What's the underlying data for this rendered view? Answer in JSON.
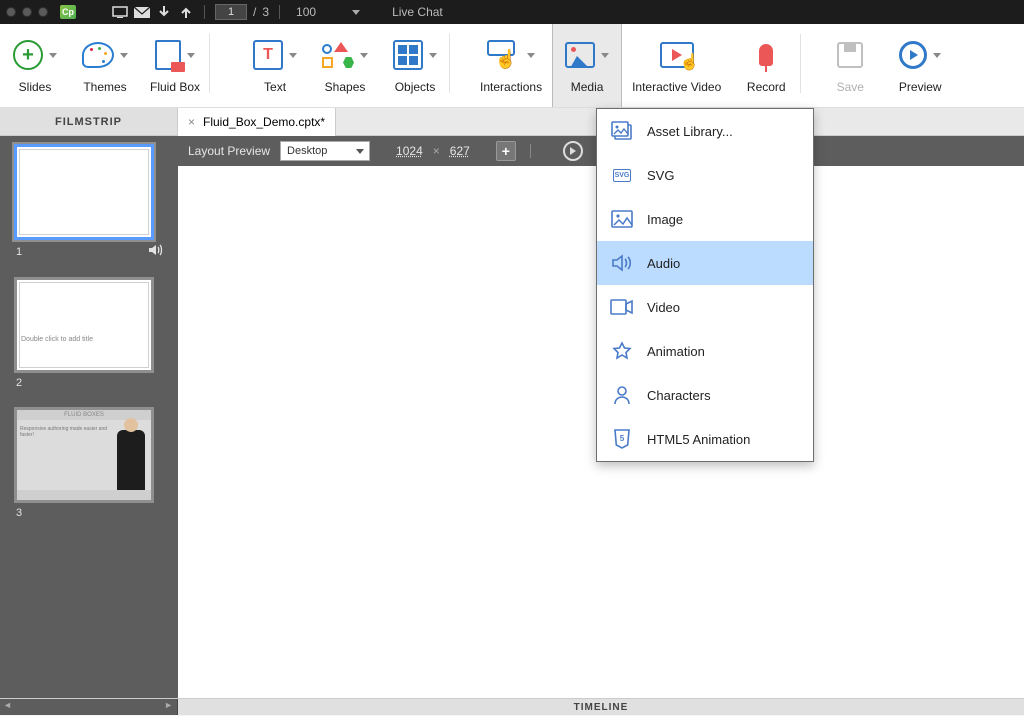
{
  "titlebar": {
    "app_code": "Cp",
    "page_current": "1",
    "page_total": "3",
    "zoom": "100",
    "live_chat": "Live Chat"
  },
  "toolbar": {
    "slides": "Slides",
    "themes": "Themes",
    "fluid_box": "Fluid Box",
    "text": "Text",
    "shapes": "Shapes",
    "objects": "Objects",
    "interactions": "Interactions",
    "media": "Media",
    "interactive_video": "Interactive Video",
    "record": "Record",
    "save": "Save",
    "preview": "Preview"
  },
  "file_tab": {
    "name": "Fluid_Box_Demo.cptx*",
    "filmstrip_header": "FILMSTRIP"
  },
  "edit_bar": {
    "layout_label": "Layout Preview",
    "device": "Desktop",
    "w": "1024",
    "h": "627"
  },
  "filmstrip": {
    "s1": "1",
    "s2": "2",
    "s3": "3",
    "s2_placeholder": "Double click to add title",
    "s3_title": "FLUID BOXES",
    "s3_text": "Responsive authoring made easier and faster!"
  },
  "dropdown": {
    "items": [
      "Asset Library...",
      "SVG",
      "Image",
      "Audio",
      "Video",
      "Animation",
      "Characters",
      "HTML5 Animation"
    ],
    "svg_badge": "SVG"
  },
  "footer": {
    "label": "TIMELINE"
  }
}
